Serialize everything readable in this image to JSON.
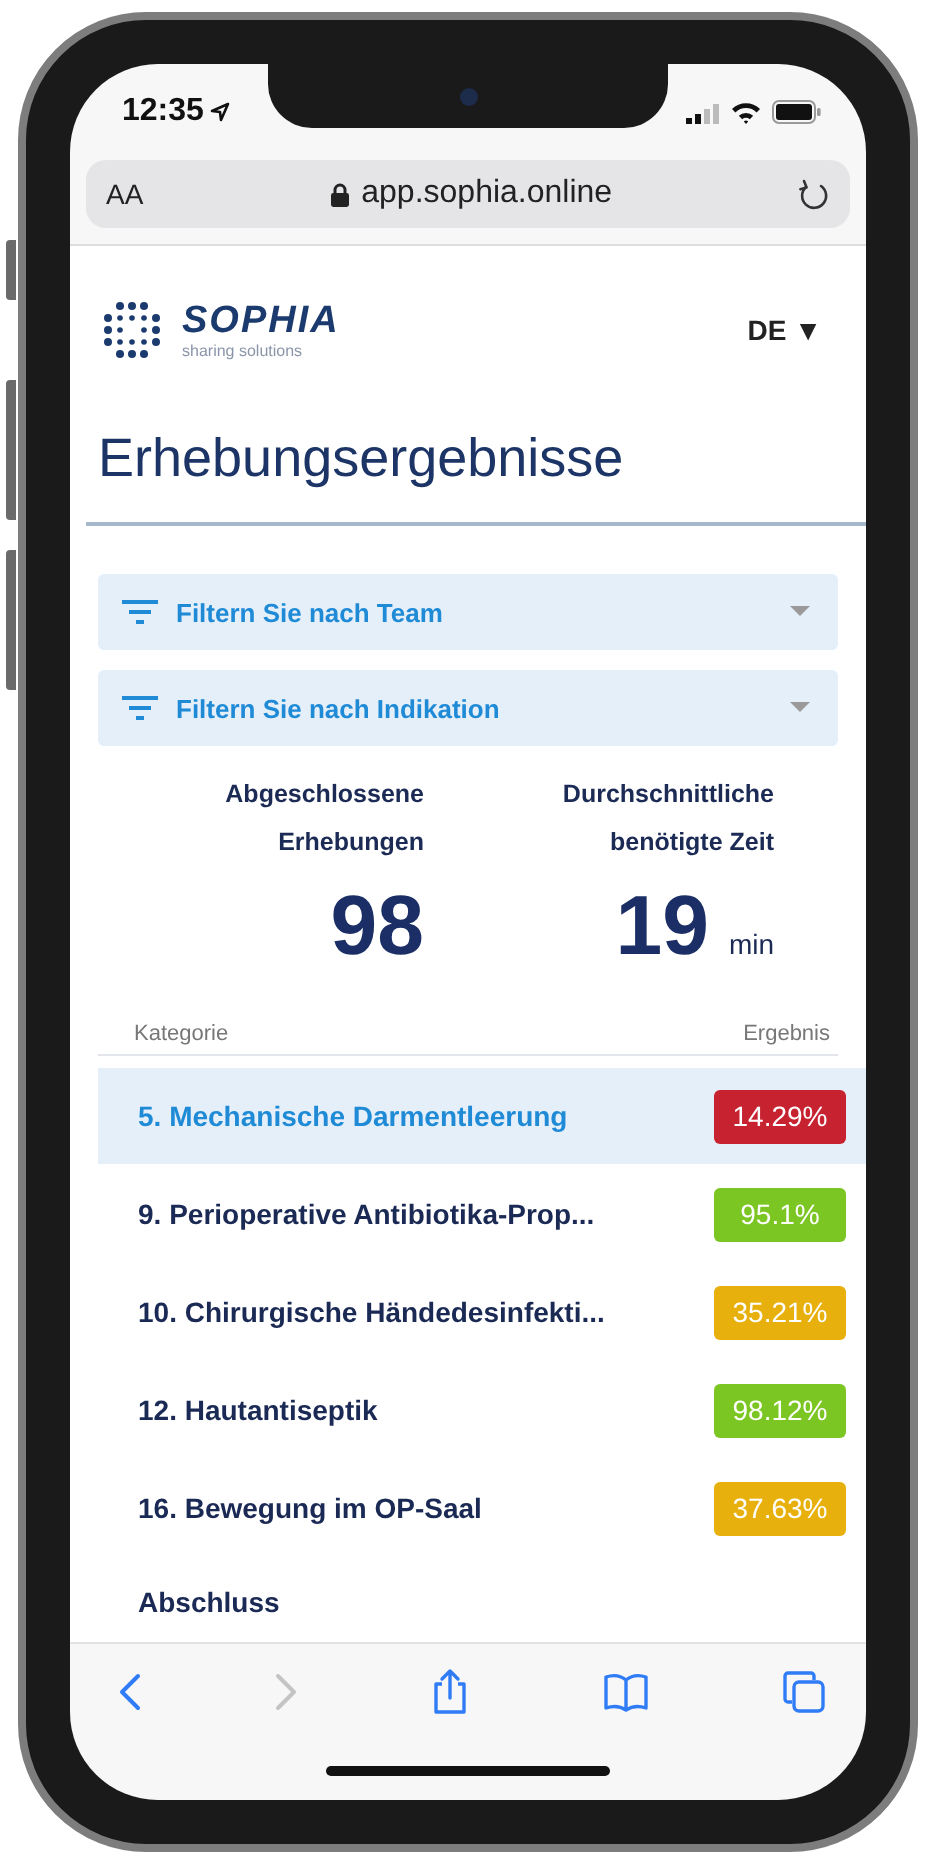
{
  "status_bar": {
    "time": "12:35"
  },
  "browser": {
    "text_size_label": "AA",
    "url": "app.sophia.online"
  },
  "header": {
    "logo_name": "SOPHIA",
    "logo_tagline": "sharing solutions",
    "language": "DE ▼"
  },
  "page_title": "Erhebungsergebnisse",
  "filters": [
    {
      "label": "Filtern Sie nach Team"
    },
    {
      "label": "Filtern Sie nach Indikation"
    }
  ],
  "stats": [
    {
      "label_lines": [
        "Abgeschlossene",
        "Erhebungen"
      ],
      "value": "98"
    },
    {
      "label_lines": [
        "Durchschnittliche",
        "benötigte Zeit"
      ],
      "value": "19",
      "unit": "min"
    }
  ],
  "table": {
    "columns": [
      "Kategorie",
      "Ergebnis"
    ],
    "rows": [
      {
        "category": "5. Mechanische Darmentleerung",
        "result": "14.29%",
        "color": "#c62230",
        "selected": true
      },
      {
        "category": "9. Perioperative Antibiotika-Prop...",
        "result": "95.1%",
        "color": "#7cc623",
        "selected": false
      },
      {
        "category": "10. Chirurgische Händedesinfekti...",
        "result": "35.21%",
        "color": "#e8b00c",
        "selected": false
      },
      {
        "category": "12. Hautantiseptik",
        "result": "98.12%",
        "color": "#7cc623",
        "selected": false
      },
      {
        "category": "16. Bewegung im OP-Saal",
        "result": "37.63%",
        "color": "#e8b00c",
        "selected": false
      }
    ]
  },
  "section_heading": "Abschluss",
  "toolbar": [
    {
      "kind": "back",
      "disabled": false
    },
    {
      "kind": "forward",
      "disabled": true
    },
    {
      "kind": "share",
      "disabled": false
    },
    {
      "kind": "bookmarks",
      "disabled": false
    },
    {
      "kind": "tabs",
      "disabled": false
    }
  ]
}
